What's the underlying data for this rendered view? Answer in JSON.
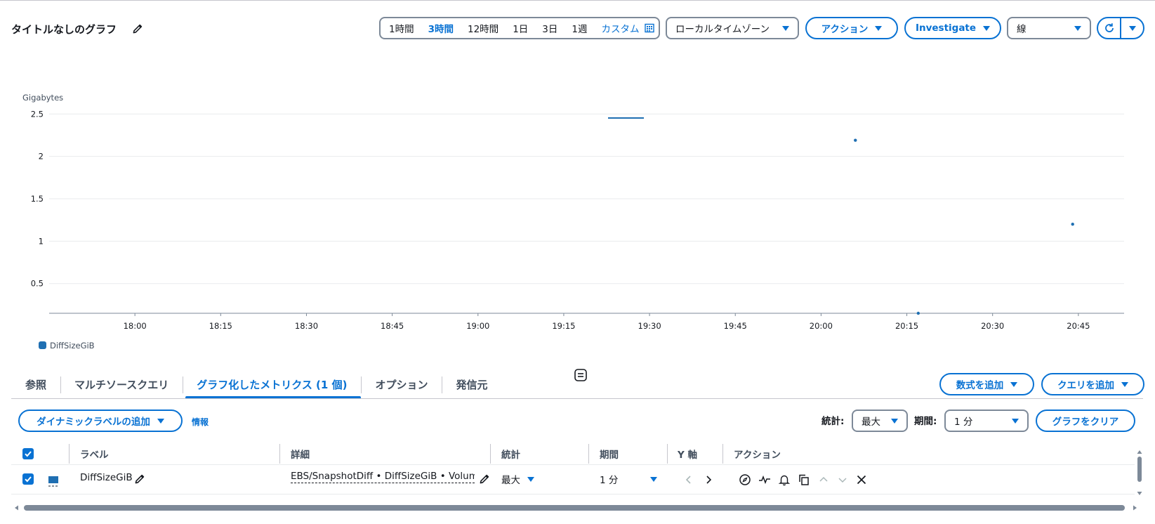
{
  "header": {
    "title": "タイトルなしのグラフ",
    "time_ranges": [
      "1時間",
      "3時間",
      "12時間",
      "1日",
      "3日",
      "1週"
    ],
    "active_time_range": "3時間",
    "custom_label": "カスタム",
    "timezone": "ローカルタイムゾーン",
    "actions_label": "アクション",
    "investigate_label": "Investigate",
    "chart_type": "線"
  },
  "chart_data": {
    "type": "line",
    "ylabel": "Gigabytes",
    "y_ticks": [
      "0.5",
      "1",
      "1.5",
      "2",
      "2.5"
    ],
    "x_ticks": [
      "18:00",
      "18:15",
      "18:30",
      "18:45",
      "19:00",
      "19:15",
      "19:30",
      "19:45",
      "20:00",
      "20:15",
      "20:30",
      "20:45"
    ],
    "ylim": [
      0.15,
      2.85
    ],
    "series": [
      {
        "name": "DiffSizeGiB",
        "color": "#1f6fb2",
        "points": [
          {
            "x": "20:06",
            "y": 2.19
          },
          {
            "x": "20:17",
            "y": 0.15
          },
          {
            "x": "20:44",
            "y": 1.2
          }
        ]
      }
    ],
    "legend_position": "bottom-left",
    "grid": true
  },
  "tabs": {
    "items": [
      "参照",
      "マルチソースクエリ",
      "グラフ化したメトリクス (1 個)",
      "オプション",
      "発信元"
    ],
    "active": "グラフ化したメトリクス (1 個)"
  },
  "toolbar": {
    "add_math": "数式を追加",
    "add_query": "クエリを追加",
    "dynamic_label": "ダイナミックラベルの追加",
    "info": "情報",
    "stat_label": "統計:",
    "stat_value": "最大",
    "period_label": "期間:",
    "period_value": "1 分",
    "clear_graph": "グラフをクリア"
  },
  "table": {
    "headers": {
      "label": "ラベル",
      "details": "詳細",
      "stat": "統計",
      "period": "期間",
      "yaxis": "Y 軸",
      "actions": "アクション"
    },
    "rows": [
      {
        "label": "DiffSizeGiB",
        "details": "EBS/SnapshotDiff • DiffSizeGiB • VolumeId",
        "stat": "最大",
        "period": "1 分",
        "color": "#1f6fb2"
      }
    ]
  }
}
